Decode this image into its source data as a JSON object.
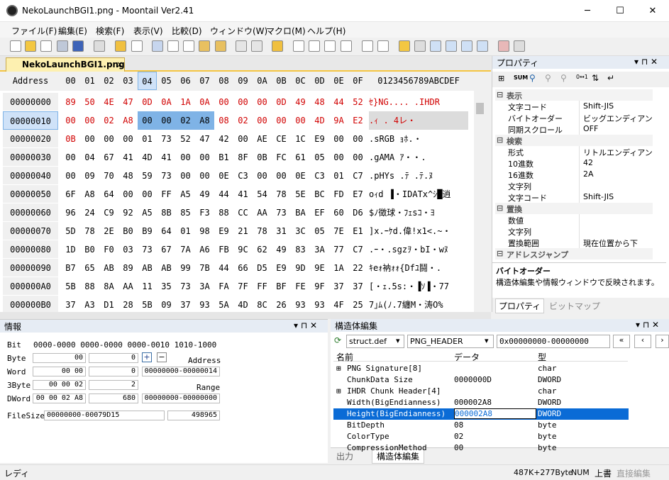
{
  "window": {
    "title": "NekoLaunchBGI1.png - Moontail Ver2.41",
    "minimize": "─",
    "maximize": "☐",
    "close": "✕"
  },
  "menu": [
    "ファイル(F)",
    "編集(E)",
    "検索(F)",
    "表示(V)",
    "比較(D)",
    "ウィンドウ(W)",
    "マクロ(M)",
    "ヘルプ(H)"
  ],
  "tab": {
    "label": "NekoLaunchBGI1.png",
    "close": "×"
  },
  "hex": {
    "header_address": "Address",
    "columns": [
      "00",
      "01",
      "02",
      "03",
      "04",
      "05",
      "06",
      "07",
      "08",
      "09",
      "0A",
      "0B",
      "0C",
      "0D",
      "0E",
      "0F"
    ],
    "text_header": "0123456789ABCDEF",
    "rows": [
      {
        "addr": "00000000",
        "bytes": [
          "89",
          "50",
          "4E",
          "47",
          "0D",
          "0A",
          "1A",
          "0A",
          "00",
          "00",
          "00",
          "0D",
          "49",
          "48",
          "44",
          "52"
        ],
        "text": "ｾ}NG....   .IHDR"
      },
      {
        "addr": "00000010",
        "bytes": [
          "00",
          "00",
          "02",
          "A8",
          "00",
          "00",
          "02",
          "A8",
          "08",
          "02",
          "00",
          "00",
          "00",
          "4D",
          "9A",
          "E2"
        ],
        "text": "   .ｨ    .   4レ・"
      },
      {
        "addr": "00000020",
        "bytes": [
          "0B",
          "00",
          "00",
          "00",
          "01",
          "73",
          "52",
          "47",
          "42",
          "00",
          "AE",
          "CE",
          "1C",
          "E9",
          "00",
          "00"
        ],
        "text": "     .sRGB ｮﾎ.・"
      },
      {
        "addr": "00000030",
        "bytes": [
          "00",
          "04",
          "67",
          "41",
          "4D",
          "41",
          "00",
          "00",
          "B1",
          "8F",
          "0B",
          "FC",
          "61",
          "05",
          "00",
          "00"
        ],
        "text": " .gAMA  ｱ・・."
      },
      {
        "addr": "00000040",
        "bytes": [
          "00",
          "09",
          "70",
          "48",
          "59",
          "73",
          "00",
          "00",
          "0E",
          "C3",
          "00",
          "00",
          "0E",
          "C3",
          "01",
          "C7"
        ],
        "text": " .pHYs  .ﾃ  .ﾃ.ﾇ"
      },
      {
        "addr": "00000050",
        "bytes": [
          "6F",
          "A8",
          "64",
          "00",
          "00",
          "FF",
          "A5",
          "49",
          "44",
          "41",
          "54",
          "78",
          "5E",
          "BC",
          "FD",
          "E7"
        ],
        "text": "oｨd  ▐・IDATx^ｼ█逍"
      },
      {
        "addr": "00000060",
        "bytes": [
          "96",
          "24",
          "C9",
          "92",
          "A5",
          "8B",
          "85",
          "F3",
          "88",
          "CC",
          "AA",
          "73",
          "BA",
          "EF",
          "60",
          "D6"
        ],
        "text": "$ﾉ徴球・ﾌｪsｺ・ﾖ"
      },
      {
        "addr": "00000070",
        "bytes": [
          "5D",
          "78",
          "2E",
          "B0",
          "B9",
          "64",
          "01",
          "98",
          "E9",
          "21",
          "78",
          "31",
          "3C",
          "05",
          "7E",
          "E1"
        ],
        "text": "]x.ｰｹd.偉!x1<.~・"
      },
      {
        "addr": "00000080",
        "bytes": [
          "1D",
          "B0",
          "F0",
          "03",
          "73",
          "67",
          "7A",
          "A6",
          "FB",
          "9C",
          "62",
          "49",
          "83",
          "3A",
          "77",
          "C7"
        ],
        "text": ".ｰ・.sgzｦ・bI・wﾇ"
      },
      {
        "addr": "00000090",
        "bytes": [
          "B7",
          "65",
          "AB",
          "89",
          "AB",
          "AB",
          "99",
          "7B",
          "44",
          "66",
          "D5",
          "E9",
          "9D",
          "9E",
          "1A",
          "22"
        ],
        "text": "ｷeｫ衲ｫｫ{Dfﾕ鬪・."
      },
      {
        "addr": "000000A0",
        "bytes": [
          "5B",
          "88",
          "8A",
          "AA",
          "11",
          "35",
          "73",
          "3A",
          "FA",
          "7F",
          "FF",
          "BF",
          "FE",
          "9F",
          "37",
          "37"
        ],
        "text": "[・ｪ.5s:・▐ｿ▐・77"
      },
      {
        "addr": "000000B0",
        "bytes": [
          "37",
          "A3",
          "D1",
          "28",
          "5B",
          "09",
          "37",
          "93",
          "5A",
          "4D",
          "8C",
          "26",
          "93",
          "93",
          "4F",
          "25"
        ],
        "text": "7｣ﾑ(ﾉ.7纏M・涛O%"
      }
    ]
  },
  "info": {
    "title": "情報",
    "bit_label": "Bit",
    "bit_value": "0000-0000  0000-0000  0000-0010  1010-1000",
    "byte_label": "Byte",
    "byte_hex": "00",
    "byte_dec": "0",
    "word_label": "Word",
    "word_hex": "00 00",
    "word_dec": "0",
    "byte3_label": "3Byte",
    "byte3_hex": "00 00 02",
    "byte3_dec": "2",
    "dword_label": "DWord",
    "dword_hex": "00 00 02 A8",
    "dword_dec": "680",
    "address_label": "Address",
    "address_value": "00000000-00000014",
    "range_label": "Range",
    "range_value": "00000000-00000000",
    "filesize_label": "FileSize",
    "filesize_hex": "00000000-00079D15",
    "filesize_dec": "498965",
    "plus": "+",
    "minus": "−"
  },
  "struct": {
    "title": "構造体編集",
    "file_select": "struct.def",
    "struct_select": "PNG_HEADER",
    "address": "0x00000000-00000000",
    "col_name": "名前",
    "col_data": "データ",
    "col_type": "型",
    "rows": [
      {
        "name": "PNG Signature[8]",
        "data": "",
        "type": "char",
        "expand": "⊞"
      },
      {
        "name": "ChunkData Size",
        "data": "0000000D",
        "type": "DWORD",
        "expand": ""
      },
      {
        "name": "IHDR Chunk Header[4]",
        "data": "",
        "type": "char",
        "expand": "⊞"
      },
      {
        "name": "Width(BigEndianness)",
        "data": "000002A8",
        "type": "DWORD",
        "expand": ""
      },
      {
        "name": "Height(BigEndianness)",
        "data": "000002A8",
        "type": "DWORD",
        "expand": ""
      },
      {
        "name": "BitDepth",
        "data": "08",
        "type": "byte",
        "expand": ""
      },
      {
        "name": "ColorType",
        "data": "02",
        "type": "byte",
        "expand": ""
      },
      {
        "name": "CompressionMethod",
        "data": "00",
        "type": "byte",
        "expand": ""
      }
    ],
    "tab_output": "出力",
    "tab_struct": "構造体編集"
  },
  "props": {
    "title": "プロパティ",
    "rows": [
      {
        "group": true,
        "name": "表示"
      },
      {
        "name": "文字コード",
        "value": "Shift-JIS"
      },
      {
        "name": "バイトオーダー",
        "value": "ビッグエンディアン"
      },
      {
        "name": "同期スクロール",
        "value": "OFF"
      },
      {
        "group": true,
        "name": "検索"
      },
      {
        "name": "形式",
        "value": "リトルエンディアン"
      },
      {
        "name": "10進数",
        "value": "42"
      },
      {
        "name": "16進数",
        "value": "2A"
      },
      {
        "name": "文字列",
        "value": ""
      },
      {
        "name": "文字コード",
        "value": "Shift-JIS"
      },
      {
        "group": true,
        "name": "置換"
      },
      {
        "name": "数値",
        "value": ""
      },
      {
        "name": "文字列",
        "value": ""
      },
      {
        "name": "置換範囲",
        "value": "現在位置から下"
      },
      {
        "group": true,
        "name": "アドレスジャンプ"
      }
    ],
    "desc_title": "バイトオーダー",
    "desc_text": "構造体編集や情報ウィンドウで反映されます。",
    "tab_props": "プロパティ",
    "tab_bitmap": "ビットマップ"
  },
  "status": {
    "left": "レディ",
    "size": "487K+277Byte",
    "num": "NUM",
    "mode": "上書",
    "direct": "直接編集"
  }
}
